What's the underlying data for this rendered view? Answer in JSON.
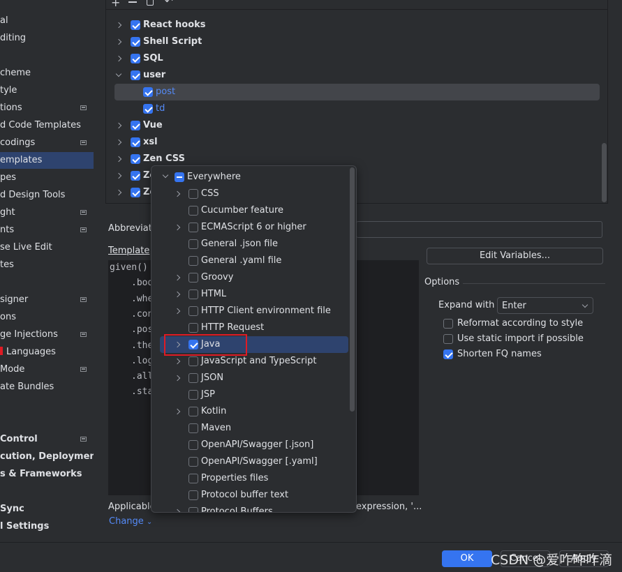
{
  "colors": {
    "accent": "#3574f0",
    "selection": "#2e436e",
    "background": "#2b2d30",
    "editor": "#1e1f22",
    "highlight_box": "#e01b24"
  },
  "sidebar": {
    "items": [
      {
        "label": "al"
      },
      {
        "label": "diting"
      },
      {
        "label": ""
      },
      {
        "label": "cheme"
      },
      {
        "label": "tyle"
      },
      {
        "label": "tions",
        "icon": true
      },
      {
        "label": "d Code Templates"
      },
      {
        "label": "codings",
        "icon": true
      },
      {
        "label": "emplates",
        "selected": true
      },
      {
        "label": "pes"
      },
      {
        "label": "d Design Tools"
      },
      {
        "label": "ght",
        "icon": true
      },
      {
        "label": "nts",
        "icon": true
      },
      {
        "label": "se Live Edit"
      },
      {
        "label": "tes"
      },
      {
        "label": ""
      },
      {
        "label": "signer",
        "icon": true
      },
      {
        "label": "ons"
      },
      {
        "label": "ge Injections",
        "icon": true
      },
      {
        "label": "Languages",
        "red_mark": true
      },
      {
        "label": "Mode",
        "icon": true
      },
      {
        "label": "ate Bundles"
      },
      {
        "label": ""
      },
      {
        "label": ""
      },
      {
        "label": "Control",
        "icon": true,
        "bold": true
      },
      {
        "label": "cution, Deployment",
        "bold": true
      },
      {
        "label": "s & Frameworks",
        "bold": true
      },
      {
        "label": ""
      },
      {
        "label": "Sync",
        "bold": true
      },
      {
        "label": "l Settings",
        "bold": true
      }
    ]
  },
  "toolbar": {
    "icons": [
      "add-icon",
      "remove-icon",
      "copy-icon",
      "undo-icon"
    ]
  },
  "tree": {
    "rows": [
      {
        "label": "React hooks",
        "level": 0,
        "checked": true,
        "expandable": true
      },
      {
        "label": "Shell Script",
        "level": 0,
        "checked": true,
        "expandable": true
      },
      {
        "label": "SQL",
        "level": 0,
        "checked": true,
        "expandable": true
      },
      {
        "label": "user",
        "level": 0,
        "checked": true,
        "expandable": true,
        "expanded": true
      },
      {
        "label": "post",
        "level": 1,
        "checked": true,
        "selected": true
      },
      {
        "label": "td",
        "level": 1,
        "checked": true
      },
      {
        "label": "Vue",
        "level": 0,
        "checked": true,
        "expandable": true
      },
      {
        "label": "xsl",
        "level": 0,
        "checked": true,
        "expandable": true
      },
      {
        "label": "Zen CSS",
        "level": 0,
        "checked": true,
        "expandable": true
      },
      {
        "label": "Ze",
        "level": 0,
        "checked": true,
        "expandable": true
      },
      {
        "label": "Ze",
        "level": 0,
        "checked": true,
        "expandable": true
      }
    ]
  },
  "form": {
    "abbreviation_label": "Abbreviat",
    "abbreviation_value": "",
    "template_text_label": "Template",
    "code_lines": [
      "given()",
      ".bod",
      ".whe",
      ".con",
      ".pos",
      ".the",
      ".log",
      ".all",
      ".sta"
    ],
    "applicable_label": "Applicable",
    "applicable_tail": "expression, '...",
    "change_link": "Change"
  },
  "options": {
    "edit_variables": "Edit Variables...",
    "title": "Options",
    "expand_with_label": "Expand with",
    "expand_with_value": "Enter",
    "checkboxes": [
      {
        "label": "Reformat according to style",
        "checked": false
      },
      {
        "label": "Use static import if possible",
        "checked": false
      },
      {
        "label": "Shorten FQ names",
        "checked": true
      }
    ]
  },
  "popup": {
    "root": {
      "label": "Everywhere",
      "state": "mixed"
    },
    "items": [
      {
        "label": "CSS",
        "expandable": true,
        "checked": false
      },
      {
        "label": "Cucumber feature",
        "checked": false
      },
      {
        "label": "ECMAScript 6 or higher",
        "expandable": true,
        "checked": false
      },
      {
        "label": "General .json file",
        "checked": false
      },
      {
        "label": "General .yaml file",
        "checked": false
      },
      {
        "label": "Groovy",
        "expandable": true,
        "checked": false
      },
      {
        "label": "HTML",
        "expandable": true,
        "checked": false
      },
      {
        "label": "HTTP Client environment file",
        "expandable": true,
        "checked": false
      },
      {
        "label": "HTTP Request",
        "checked": false
      },
      {
        "label": "Java",
        "expandable": true,
        "checked": true,
        "selected": true
      },
      {
        "label": "JavaScript and TypeScript",
        "expandable": true,
        "checked": false
      },
      {
        "label": "JSON",
        "expandable": true,
        "checked": false
      },
      {
        "label": "JSP",
        "checked": false
      },
      {
        "label": "Kotlin",
        "expandable": true,
        "checked": false
      },
      {
        "label": "Maven",
        "checked": false
      },
      {
        "label": "OpenAPI/Swagger [.json]",
        "checked": false
      },
      {
        "label": "OpenAPI/Swagger [.yaml]",
        "checked": false
      },
      {
        "label": "Properties files",
        "checked": false
      },
      {
        "label": "Protocol buffer text",
        "checked": false
      },
      {
        "label": "Protocol Buffers",
        "expandable": true,
        "checked": false
      }
    ]
  },
  "footer": {
    "ok": "OK",
    "cancel": "Cancel",
    "apply": "Apply"
  },
  "watermark": "CSDN @爱咋咋咋滴"
}
